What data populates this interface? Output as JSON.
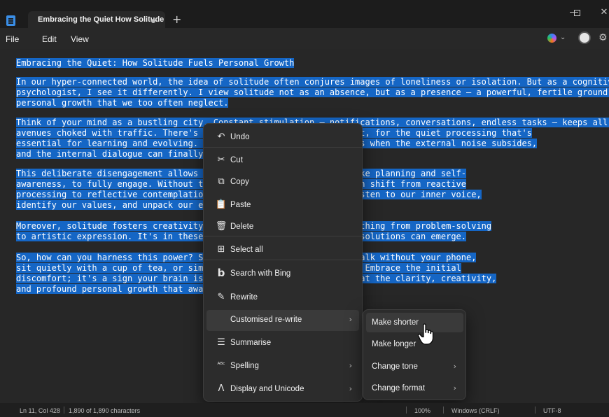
{
  "window": {
    "tab_title": "Embracing the Quiet How Solitude",
    "new_tab": "+",
    "minimize": "—",
    "maximize": "☐",
    "close": "✕"
  },
  "menubar": {
    "file": "File",
    "edit": "Edit",
    "view": "View",
    "chevron": "⌄",
    "settings": "⚙"
  },
  "document": {
    "lines": [
      {
        "text": "Embracing the Quiet: How Solitude Fuels Personal Growth",
        "selected": true
      },
      {
        "text": "",
        "selected": false
      },
      {
        "text": "In our hyper-connected world, the idea of solitude often conjures images of loneliness or isolation. But as a cognitive",
        "selected": true
      },
      {
        "text": "psychologist, I see it differently. I view solitude not as an absence, but as a presence – a powerful, fertile ground for",
        "selected": true
      },
      {
        "text": "personal growth that we too often neglect.",
        "selected": true
      },
      {
        "text": "",
        "selected": false
      },
      {
        "text": "Think of your mind as a bustling city. Constant stimulation – notifications, conversations, endless tasks – keeps all the",
        "selected": true
      },
      {
        "text": "avenues choked with traffic. There's little room for the deep thought, for the quiet processing that's",
        "selected": true
      },
      {
        "text": "essential for learning and evolving. Solitude is the quiet hour. It's when the external noise subsides,",
        "selected": true
      },
      {
        "text": "and the internal dialogue can finally ri",
        "selected": true
      },
      {
        "text": "",
        "selected": false
      },
      {
        "text": "This deliberate disengagement allows our   or executive functions like planning and self-",
        "selected": true
      },
      {
        "text": "awareness, to fully engage. Without the   nal stimuli, our brains can shift from reactive",
        "selected": true
      },
      {
        "text": "processing to reflective contemplation.   It's where we can truly listen to our inner voice,",
        "selected": true
      },
      {
        "text": "identify our values, and unpack our emot   influence.",
        "selected": true
      },
      {
        "text": "",
        "selected": false
      },
      {
        "text": "Moreover, solitude fosters creativity. W   eating. This could be anything from problem-solving",
        "selected": true
      },
      {
        "text": "to artistic expression. It's in these qu   percolate and unexpected solutions can emerge.",
        "selected": true
      },
      {
        "text": "",
        "selected": false
      },
      {
        "text": "So, how can you harness this power? Star   day to unplug. Go for a walk without your phone,",
        "selected": true
      },
      {
        "text": "sit quietly with a cup of tea, or simply   urge to fill the silence. Embrace the initial",
        "selected": true
      },
      {
        "text": "discomfort; it's a sign your brain is ad   . You might be surprised at the clarity, creativity,",
        "selected": true
      },
      {
        "text": "and profound personal growth that awaits",
        "selected": true
      }
    ]
  },
  "context_menu": {
    "items": [
      {
        "label": "Undo",
        "icon": "↶",
        "icon_name": "undo-icon"
      },
      {
        "label": "Cut",
        "icon": "✂",
        "icon_name": "cut-icon"
      },
      {
        "label": "Copy",
        "icon": "⧉",
        "icon_name": "copy-icon"
      },
      {
        "label": "Paste",
        "icon": "📋",
        "icon_name": "paste-icon"
      },
      {
        "label": "Delete",
        "icon": "🗑",
        "icon_name": "delete-icon"
      },
      {
        "label": "Select all",
        "icon": "⊞",
        "icon_name": "select-all-icon"
      },
      {
        "label": "Search with Bing",
        "icon": "b",
        "icon_name": "bing-icon"
      },
      {
        "label": "Rewrite",
        "icon": "✎",
        "icon_name": "rewrite-icon"
      },
      {
        "label": "Customised re-write",
        "icon": "",
        "icon_name": "",
        "submenu": true
      },
      {
        "label": "Summarise",
        "icon": "☰",
        "icon_name": "summarise-icon"
      },
      {
        "label": "Spelling",
        "icon": "ᴬᴮᶜ",
        "icon_name": "spelling-icon",
        "submenu": true
      },
      {
        "label": "Display and Unicode",
        "icon": "Λ",
        "icon_name": "unicode-icon",
        "submenu": true
      }
    ],
    "chevron": "›"
  },
  "submenu": {
    "items": [
      {
        "label": "Make shorter"
      },
      {
        "label": "Make longer"
      },
      {
        "label": "Change tone",
        "submenu": true
      },
      {
        "label": "Change format",
        "submenu": true
      }
    ]
  },
  "statusbar": {
    "position": "Ln 11, Col 428",
    "characters": "1,890 of 1,890 characters",
    "zoom": "100%",
    "line_ending": "Windows (CRLF)",
    "encoding": "UTF-8"
  },
  "colors": {
    "selection": "#1566c5",
    "background": "#272727",
    "menu": "#2c2c2c"
  }
}
